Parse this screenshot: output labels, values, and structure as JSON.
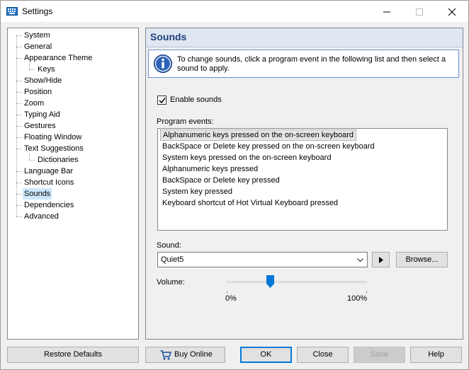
{
  "window": {
    "title": "Settings"
  },
  "tree": {
    "items": [
      {
        "label": "System",
        "level": 0
      },
      {
        "label": "General",
        "level": 0
      },
      {
        "label": "Appearance Theme",
        "level": 0
      },
      {
        "label": "Keys",
        "level": 1
      },
      {
        "label": "Show/Hide",
        "level": 0
      },
      {
        "label": "Position",
        "level": 0
      },
      {
        "label": "Zoom",
        "level": 0
      },
      {
        "label": "Typing Aid",
        "level": 0
      },
      {
        "label": "Gestures",
        "level": 0
      },
      {
        "label": "Floating Window",
        "level": 0
      },
      {
        "label": "Text Suggestions",
        "level": 0
      },
      {
        "label": "Dictionaries",
        "level": 1
      },
      {
        "label": "Language Bar",
        "level": 0
      },
      {
        "label": "Shortcut Icons",
        "level": 0
      },
      {
        "label": "Sounds",
        "level": 0,
        "selected": true
      },
      {
        "label": "Dependencies",
        "level": 0
      },
      {
        "label": "Advanced",
        "level": 0
      }
    ]
  },
  "panel": {
    "title": "Sounds",
    "info_text": "To change sounds, click a program event in the following list and then select a sound to apply.",
    "enable_sounds_label": "Enable sounds",
    "enable_sounds_checked": true,
    "events_label": "Program events:",
    "events": [
      "Alphanumeric keys pressed on the on-screen keyboard",
      "BackSpace or Delete key pressed on the on-screen keyboard",
      "System keys pressed on the on-screen keyboard",
      "Alphanumeric keys pressed",
      "BackSpace or Delete key pressed",
      "System key pressed",
      "Keyboard shortcut of Hot Virtual Keyboard pressed"
    ],
    "selected_event_index": 0,
    "sound_label": "Sound:",
    "sound_value": "Quiet5",
    "browse_label": "Browse...",
    "volume_label": "Volume:",
    "volume_min_label": "0%",
    "volume_max_label": "100%",
    "volume_percent": 31
  },
  "buttons": {
    "restore_defaults": "Restore Defaults",
    "buy_online": "Buy Online",
    "ok": "OK",
    "close": "Close",
    "save": "Save",
    "help": "Help"
  },
  "colors": {
    "accent": "#0078d7",
    "title_text": "#1f3f7a",
    "selection": "#cce8ff"
  }
}
